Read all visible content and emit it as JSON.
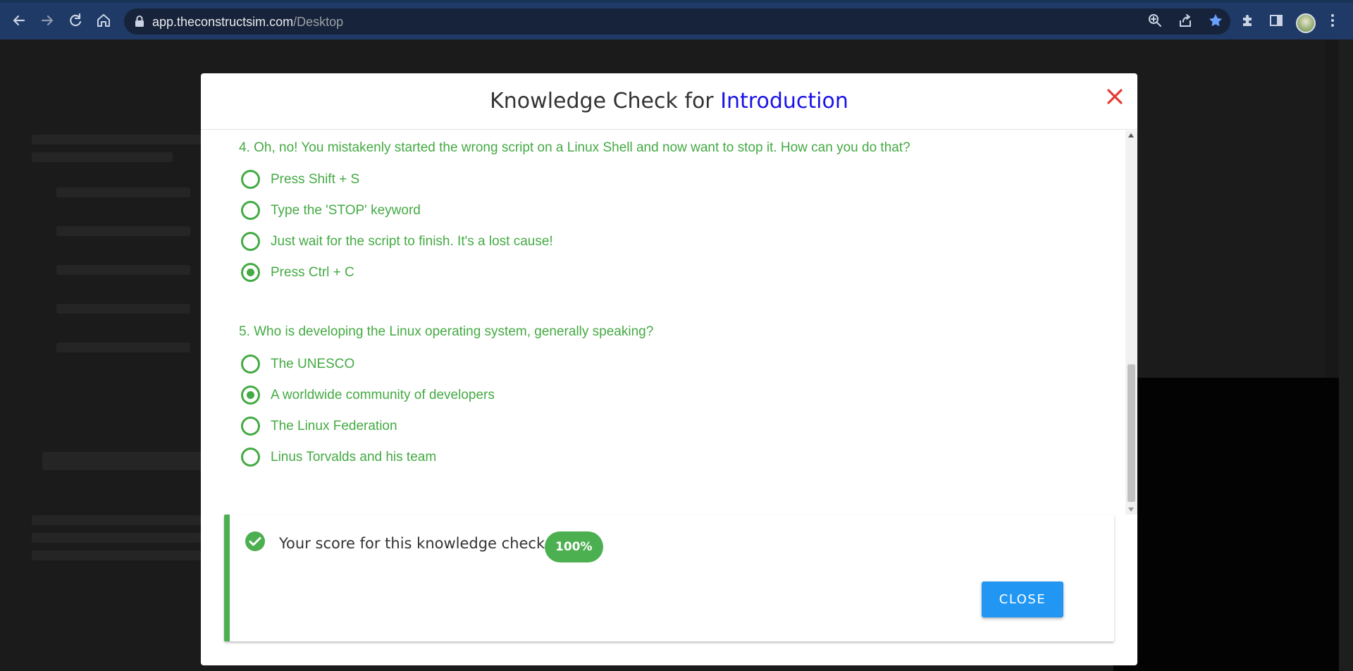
{
  "browser": {
    "url_host": "app.theconstructsim.com",
    "url_path": "/Desktop",
    "nav_icons": [
      "back-arrow-icon",
      "forward-arrow-icon",
      "reload-icon",
      "home-icon"
    ],
    "omnibox_icons": [
      "zoom-icon",
      "share-icon",
      "bookmark-star-icon"
    ],
    "toolbar_icons": [
      "extensions-puzzle-icon",
      "side-panel-icon",
      "profile-avatar",
      "kebab-menu-icon"
    ]
  },
  "modal": {
    "title_prefix": "Knowledge Check for ",
    "title_accent": "Introduction",
    "accent_color": "#1a12e6",
    "close_icon": "close-x-icon",
    "close_icon_color": "#e53935"
  },
  "questions": [
    {
      "text": "4. Oh, no! You mistakenly started the wrong script on a Linux Shell and now want to stop it. How can you do that?",
      "options": [
        {
          "label": "Press Shift + S",
          "selected": false
        },
        {
          "label": "Type the 'STOP' keyword",
          "selected": false
        },
        {
          "label": "Just wait for the script to finish. It's a lost cause!",
          "selected": false
        },
        {
          "label": "Press Ctrl + C",
          "selected": true
        }
      ]
    },
    {
      "text": "5. Who is developing the Linux operating system, generally speaking?",
      "options": [
        {
          "label": "The UNESCO",
          "selected": false
        },
        {
          "label": "A worldwide community of developers",
          "selected": true
        },
        {
          "label": "The Linux Federation",
          "selected": false
        },
        {
          "label": "Linus Torvalds and his team",
          "selected": false
        }
      ]
    }
  ],
  "result": {
    "icon": "check-circle-icon",
    "text": "Your score for this knowledge check:",
    "score": "100%",
    "close_label": "CLOSE",
    "success_color": "#4caf50",
    "button_color": "#2196f3"
  }
}
